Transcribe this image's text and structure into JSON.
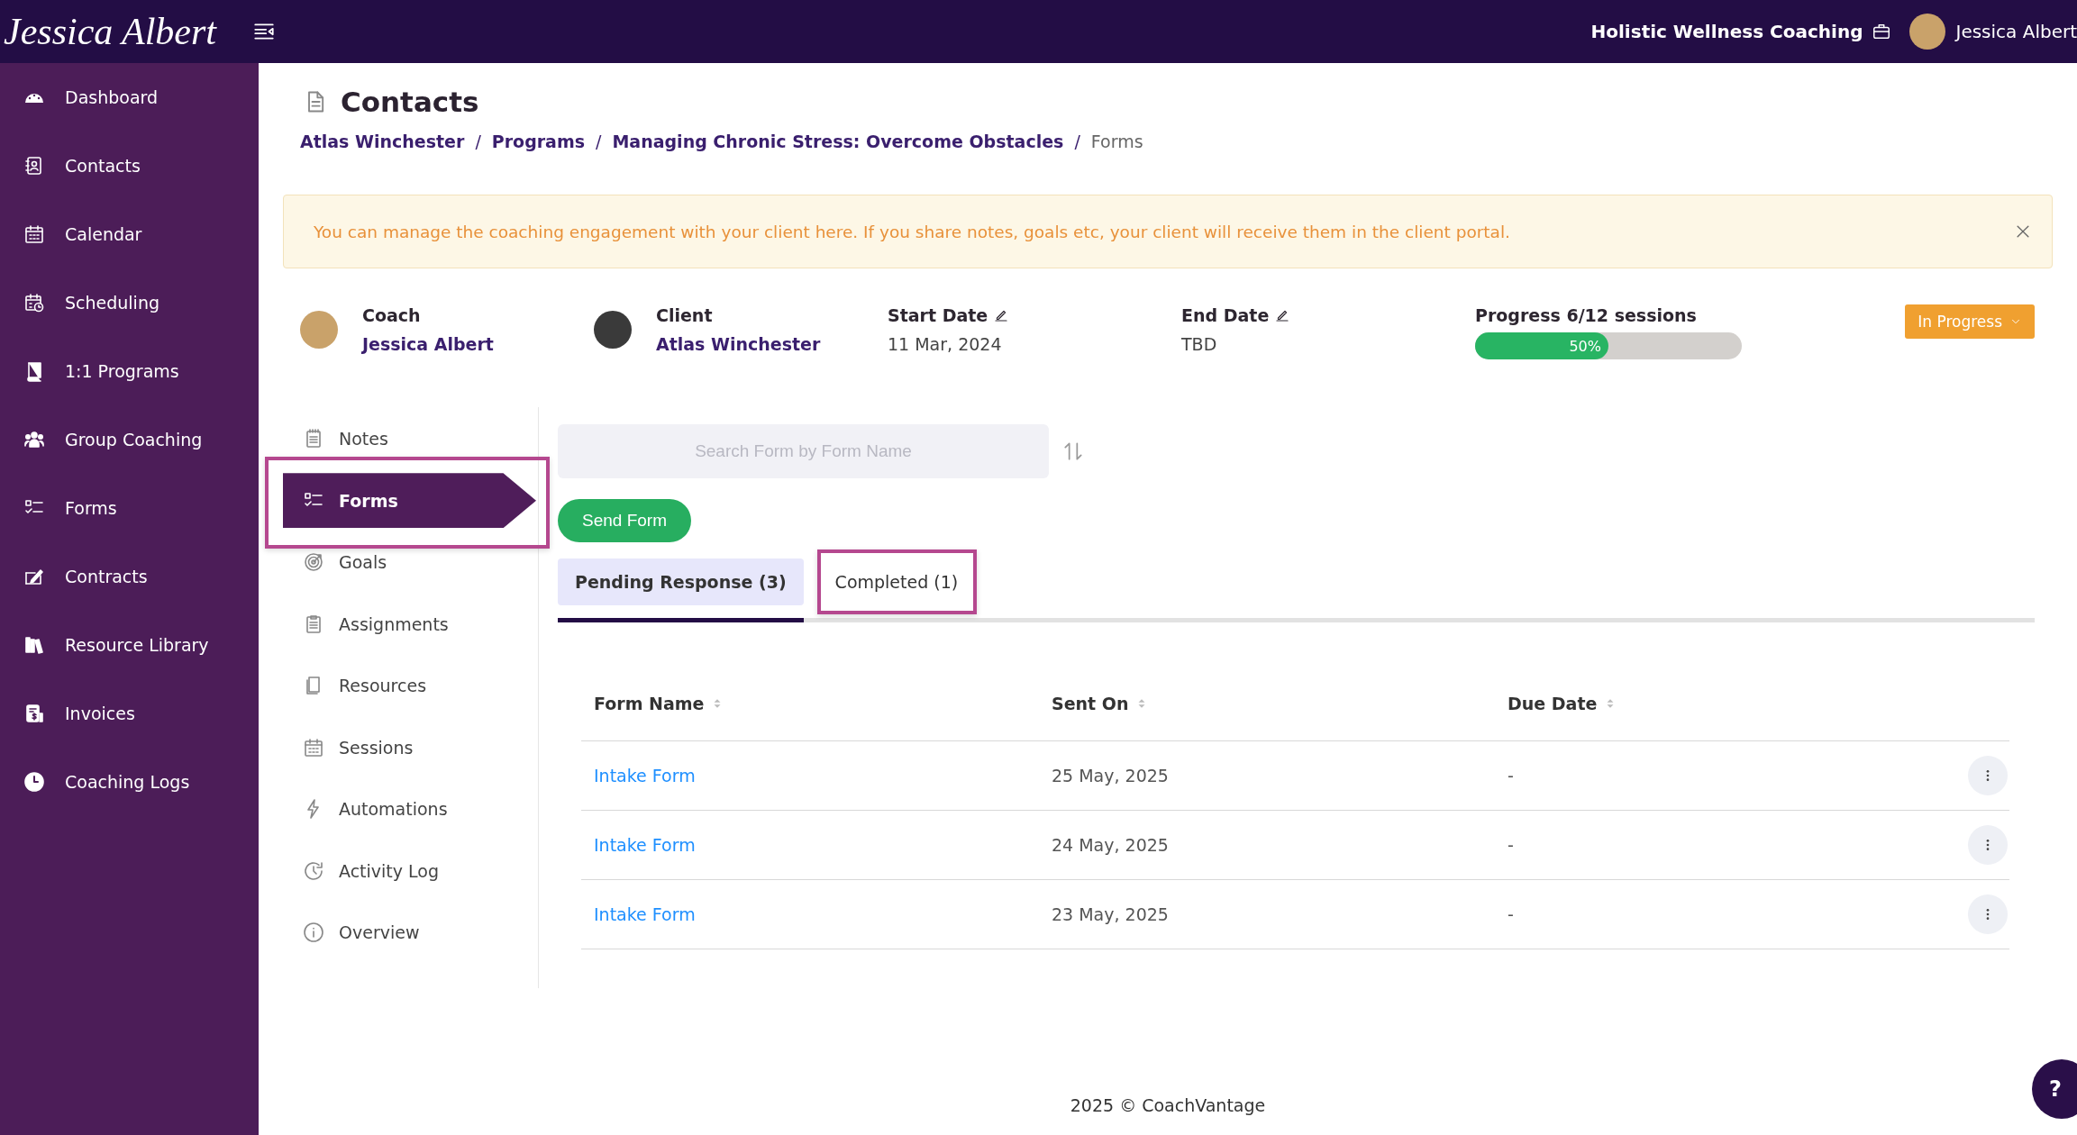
{
  "topbar": {
    "logo": "Jessica Albert",
    "business": "Holistic Wellness Coaching",
    "user": "Jessica Albert"
  },
  "sidebar": {
    "items": [
      {
        "label": "Dashboard"
      },
      {
        "label": "Contacts"
      },
      {
        "label": "Calendar"
      },
      {
        "label": "Scheduling"
      },
      {
        "label": "1:1 Programs"
      },
      {
        "label": "Group Coaching"
      },
      {
        "label": "Forms"
      },
      {
        "label": "Contracts"
      },
      {
        "label": "Resource Library"
      },
      {
        "label": "Invoices"
      },
      {
        "label": "Coaching Logs"
      }
    ]
  },
  "page": {
    "title": "Contacts",
    "breadcrumb": [
      {
        "label": "Atlas Winchester",
        "link": true
      },
      {
        "label": "Programs",
        "link": true
      },
      {
        "label": "Managing Chronic Stress: Overcome Obstacles",
        "link": true
      },
      {
        "label": "Forms",
        "link": false
      }
    ],
    "separator": "/"
  },
  "alert": {
    "text": "You can manage the coaching engagement with your client here. If you share notes, goals etc, your client will receive them in the client portal.",
    "dismissible": true
  },
  "engagement": {
    "coach": {
      "label": "Coach",
      "name": "Jessica Albert"
    },
    "client": {
      "label": "Client",
      "name": "Atlas Winchester"
    },
    "dates": [
      {
        "label": "Start Date",
        "value": "11 Mar, 2024",
        "editable": true
      },
      {
        "label": "End Date",
        "value": "TBD",
        "editable": true
      }
    ],
    "progress": {
      "label": "Progress 6/12 sessions",
      "level": 0.5,
      "reading": "50%"
    },
    "status": "In Progress"
  },
  "program_menu": [
    {
      "label": "Notes",
      "selected": false,
      "highlighted": false
    },
    {
      "label": "Forms",
      "selected": true,
      "highlighted": true
    },
    {
      "label": "Goals",
      "selected": false,
      "highlighted": false
    },
    {
      "label": "Assignments",
      "selected": false,
      "highlighted": false
    },
    {
      "label": "Resources",
      "selected": false,
      "highlighted": false
    },
    {
      "label": "Sessions",
      "selected": false,
      "highlighted": false
    },
    {
      "label": "Automations",
      "selected": false,
      "highlighted": false
    },
    {
      "label": "Activity Log",
      "selected": false,
      "highlighted": false
    },
    {
      "label": "Overview",
      "selected": false,
      "highlighted": false
    }
  ],
  "forms": {
    "search": {
      "placeholder": "Search Form by Form Name"
    },
    "send_button": "Send Form",
    "tabs": [
      {
        "label": "Pending Response (3)",
        "selected": true,
        "highlighted": false
      },
      {
        "label": "Completed (1)",
        "selected": false,
        "highlighted": true
      }
    ],
    "table": {
      "columns": [
        {
          "label": "Form Name",
          "sortable": true
        },
        {
          "label": "Sent On",
          "sortable": true
        },
        {
          "label": "Due Date",
          "sortable": true
        }
      ],
      "rows": [
        {
          "form_name": "Intake Form",
          "sent_on": "25 May, 2025",
          "due_date": "-"
        },
        {
          "form_name": "Intake Form",
          "sent_on": "24 May, 2025",
          "due_date": "-"
        },
        {
          "form_name": "Intake Form",
          "sent_on": "23 May, 2025",
          "due_date": "-"
        }
      ]
    }
  },
  "footer": "2025 © CoachVantage",
  "help_button": "?"
}
